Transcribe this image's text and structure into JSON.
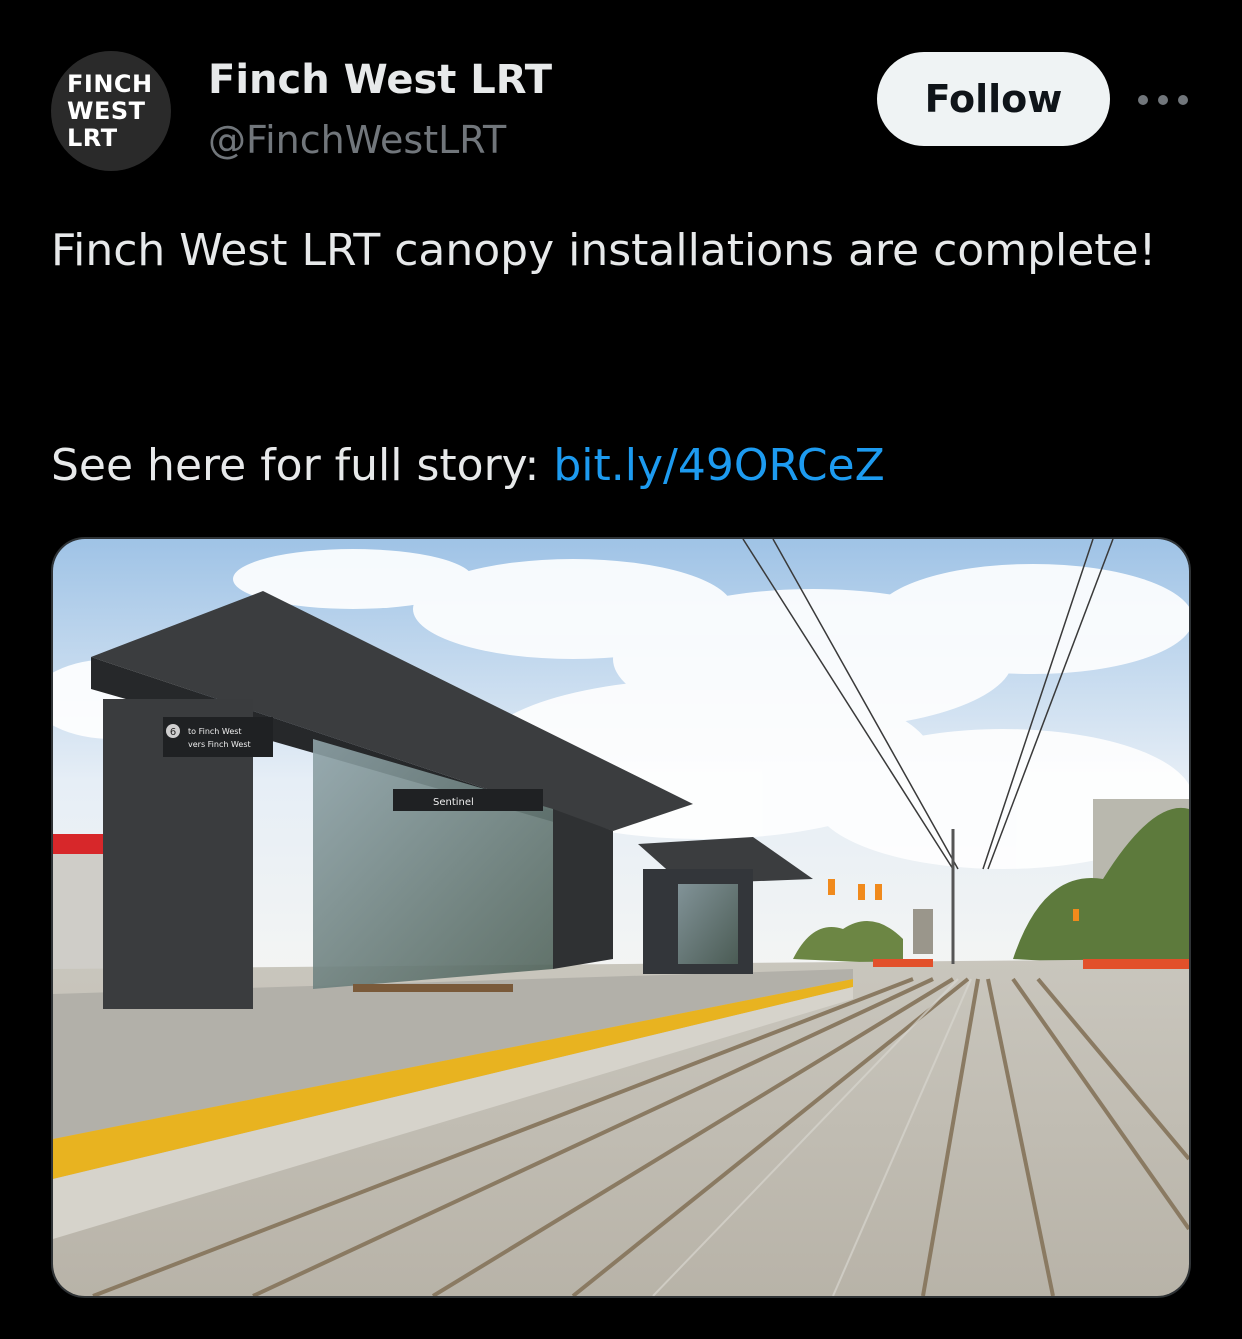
{
  "author": {
    "avatar_lines": [
      "FINCH",
      "WEST",
      "LRT"
    ],
    "display_name": "Finch West LRT",
    "handle": "@FinchWestLRT"
  },
  "actions": {
    "follow_label": "Follow",
    "more_icon": "ellipsis-horizontal-icon"
  },
  "tweet": {
    "text_line1": "Finch West LRT canopy installations are complete!",
    "story_prefix": "See here for full story:",
    "link_text": "bit.ly/49ORCeZ"
  },
  "media": {
    "sign_platform_number": "6",
    "sign_direction_en": "to Finch West",
    "sign_direction_fr": "vers Finch West",
    "station_name": "Sentinel"
  },
  "colors": {
    "background": "#000000",
    "text_primary": "#e7e9ea",
    "text_secondary": "#71767b",
    "link": "#1d9bf0",
    "follow_bg": "#eff3f4",
    "tactile_strip": "#e8b320"
  }
}
